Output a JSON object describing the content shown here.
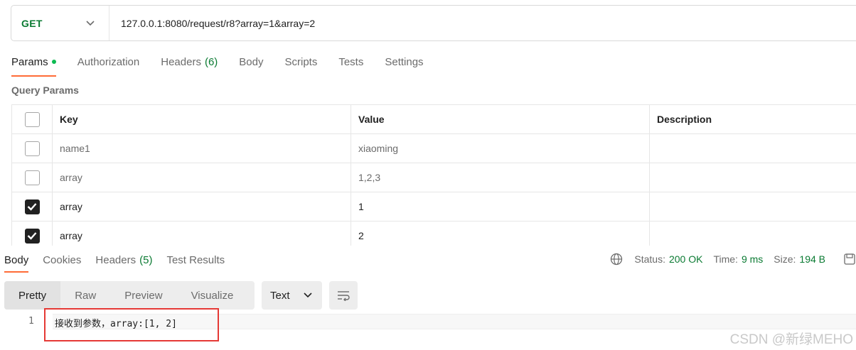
{
  "request": {
    "method": "GET",
    "url": "127.0.0.1:8080/request/r8?array=1&array=2"
  },
  "tabs": [
    {
      "label": "Params",
      "dot": true
    },
    {
      "label": "Authorization"
    },
    {
      "label": "Headers",
      "count": "(6)"
    },
    {
      "label": "Body"
    },
    {
      "label": "Scripts"
    },
    {
      "label": "Tests"
    },
    {
      "label": "Settings"
    }
  ],
  "query_params": {
    "title": "Query Params",
    "headers": {
      "key": "Key",
      "value": "Value",
      "description": "Description"
    },
    "rows": [
      {
        "checked": false,
        "key": "name1",
        "value": "xiaoming",
        "description": ""
      },
      {
        "checked": false,
        "key": "array",
        "value": "1,2,3",
        "description": ""
      },
      {
        "checked": true,
        "key": "array",
        "value": "1",
        "description": ""
      },
      {
        "checked": true,
        "key": "array",
        "value": "2",
        "description": ""
      }
    ]
  },
  "response": {
    "tabs": [
      {
        "label": "Body"
      },
      {
        "label": "Cookies"
      },
      {
        "label": "Headers",
        "count": "(5)"
      },
      {
        "label": "Test Results"
      }
    ],
    "status_label": "Status:",
    "status_value": "200 OK",
    "time_label": "Time:",
    "time_value": "9 ms",
    "size_label": "Size:",
    "size_value": "194 B",
    "formats": [
      "Pretty",
      "Raw",
      "Preview",
      "Visualize"
    ],
    "language": "Text",
    "line_number": "1",
    "body_text": "接收到参数，array:[1, 2]"
  },
  "watermark": "CSDN @新绿MEHO",
  "colors": {
    "accent": "#ff6c37",
    "green": "#0a7a32",
    "dot": "#0cbb52",
    "highlight": "#e53935"
  }
}
